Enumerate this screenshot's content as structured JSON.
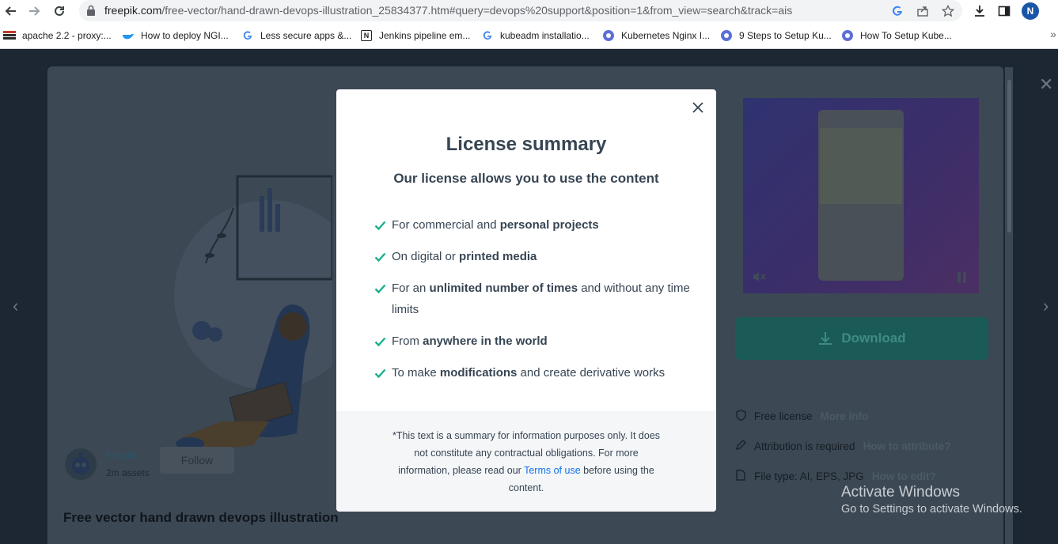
{
  "browser": {
    "url_host": "freepik.com",
    "url_path": "/free-vector/hand-drawn-devops-illustration_25834377.htm#query=devops%20support&position=1&from_view=search&track=ais",
    "profile_initial": "N"
  },
  "bookmarks": [
    {
      "label": "apache 2.2 - proxy:...",
      "icon": "apache-icon"
    },
    {
      "label": "How to deploy NGI...",
      "icon": "docker-icon"
    },
    {
      "label": "Less secure apps &...",
      "icon": "google-icon"
    },
    {
      "label": "Jenkins pipeline em...",
      "icon": "notion-icon"
    },
    {
      "label": "kubeadm installatio...",
      "icon": "google-icon"
    },
    {
      "label": "Kubernetes Nginx I...",
      "icon": "bookmark-icon"
    },
    {
      "label": "9 Steps to Setup Ku...",
      "icon": "bookmark-icon"
    },
    {
      "label": "How To Setup Kube...",
      "icon": "bookmark-icon"
    }
  ],
  "background_page": {
    "download_label": "Download",
    "meta": [
      {
        "label": "Free license",
        "link": "More info",
        "icon": "shield-icon"
      },
      {
        "label": "Attribution is required",
        "link": "How to attribute?",
        "icon": "pen-icon"
      },
      {
        "label": "File type: AI, EPS, JPG",
        "link": "How to edit?",
        "icon": "file-icon"
      }
    ],
    "author_name": "freepik",
    "author_assets": "2m assets",
    "follow_label": "Follow",
    "title": "Free vector hand drawn devops illustration"
  },
  "modal": {
    "title": "License summary",
    "subtitle": "Our license allows you to use the content",
    "features": [
      {
        "pre": "For commercial and ",
        "bold": "personal projects",
        "post": ""
      },
      {
        "pre": "On digital or ",
        "bold": "printed media",
        "post": ""
      },
      {
        "pre": "For an ",
        "bold": "unlimited number of times",
        "post": " and without any time limits"
      },
      {
        "pre": "From ",
        "bold": "anywhere in the world",
        "post": ""
      },
      {
        "pre": "To make ",
        "bold": "modifications",
        "post": " and create derivative works"
      }
    ],
    "footer_pre": "*This text is a summary for information purposes only. It does not constitute any contractual obligations. For more information, please read our ",
    "footer_link": "Terms of use",
    "footer_post": " before using the content."
  },
  "windows_watermark": {
    "line1": "Activate Windows",
    "line2": "Go to Settings to activate Windows."
  },
  "colors": {
    "check": "#1bb08f",
    "link": "#1273eb",
    "text": "#374553"
  }
}
